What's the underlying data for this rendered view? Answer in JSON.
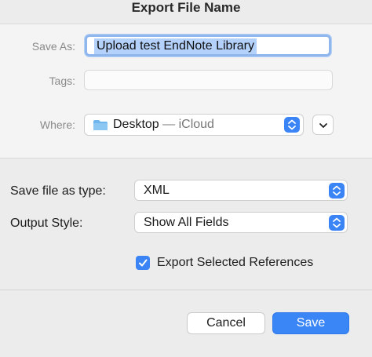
{
  "dialog": {
    "title": "Export File Name"
  },
  "save_as": {
    "label": "Save As:",
    "value": "Upload test EndNote Library"
  },
  "tags": {
    "label": "Tags:",
    "value": ""
  },
  "where": {
    "label": "Where:",
    "location": "Desktop",
    "separator": " — ",
    "provider": "iCloud",
    "icon": "folder-icon"
  },
  "file_type": {
    "label": "Save file as type:",
    "value": "XML"
  },
  "output_style": {
    "label": "Output Style:",
    "value": "Show All Fields"
  },
  "export_selected": {
    "label": "Export Selected References",
    "checked": true
  },
  "buttons": {
    "cancel": "Cancel",
    "save": "Save"
  },
  "colors": {
    "accent": "#3a86f6",
    "selection": "#b3d1fb",
    "focus_ring": "#8fb7ee"
  }
}
